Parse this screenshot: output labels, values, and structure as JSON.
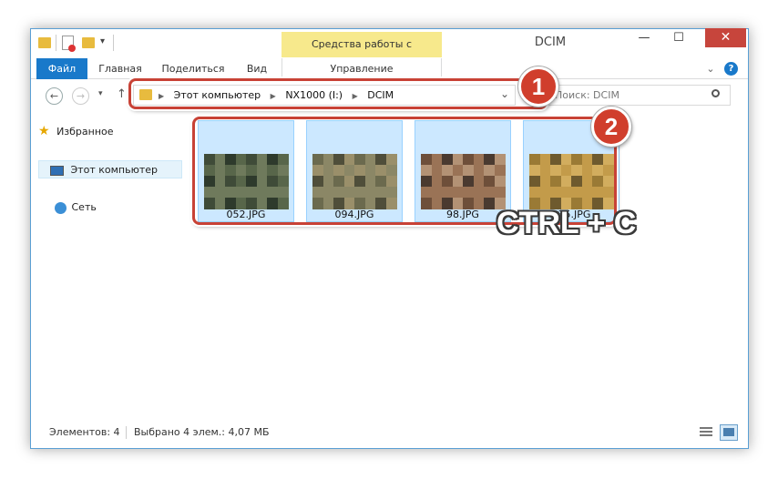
{
  "window": {
    "title": "DCIM",
    "context_tab": "Средства работы с рисунками",
    "minimize": "—",
    "maximize": "☐",
    "close": "✕"
  },
  "ribbon": {
    "tabs": [
      "Файл",
      "Главная",
      "Поделиться",
      "Вид"
    ],
    "manage_tab": "Управление",
    "expand_icon": "⌄",
    "help_icon": "?"
  },
  "navigation": {
    "back": "←",
    "forward": "→",
    "recent": "▾",
    "up": "↑",
    "breadcrumb": [
      "Этот компьютер",
      "NX1000 (I:)",
      "DCIM"
    ],
    "address_dropdown": "⌄",
    "search_placeholder": "Поиск: DCIM"
  },
  "nav_pane": {
    "items": [
      "Избранное",
      "Этот компьютер",
      "Сеть"
    ]
  },
  "files": [
    {
      "name": "052.JPG",
      "colors": [
        "#3f4b38",
        "#6f7a5c",
        "#2e3a2c",
        "#58664a"
      ]
    },
    {
      "name": "094.JPG",
      "colors": [
        "#6b6a4e",
        "#8b8766",
        "#4f4e3a",
        "#9a8f6a"
      ]
    },
    {
      "name": "98.JPG",
      "colors": [
        "#6e4f3a",
        "#9a7356",
        "#4a3a30",
        "#b39275"
      ]
    },
    {
      "name": "135.JPG",
      "colors": [
        "#9a7a35",
        "#c39b4a",
        "#6e5a2e",
        "#d2ad5e"
      ]
    }
  ],
  "status": {
    "count": "Элементов: 4",
    "selected": "Выбрано 4 элем.: 4,07 МБ"
  },
  "annotations": {
    "step1": "1",
    "step2": "2",
    "shortcut": "CTRL + C",
    "accent_color": "#c84236"
  }
}
